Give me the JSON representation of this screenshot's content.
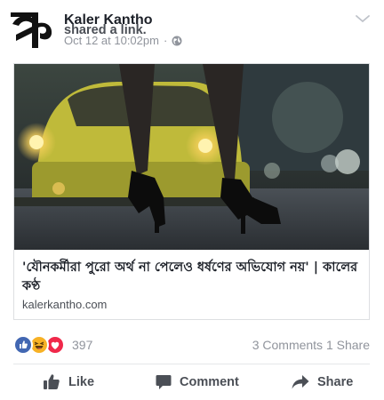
{
  "post": {
    "author": "Kaler Kantho",
    "action": "shared a link.",
    "timestamp": "Oct 12 at 10:02pm",
    "separator": "·",
    "audience_icon": "globe-icon",
    "logo_icon": "kaler-kantho-logo",
    "menu_icon": "chevron-down-icon"
  },
  "link_card": {
    "image": "photo-woman-legs-high-heels-street-night-taxi",
    "title": "'যৌনকর্মীরা পুরো অর্থ না পেলেও ধর্ষণের অভিযোগ নয়' | কালের কণ্ঠ",
    "domain": "kalerkantho.com"
  },
  "engagement": {
    "reactions": [
      "like",
      "haha",
      "love"
    ],
    "reaction_count": "397",
    "comments": "3 Comments",
    "shares": "1 Share"
  },
  "actions": {
    "like": "Like",
    "comment": "Comment",
    "share": "Share"
  },
  "colors": {
    "like_blue": "#4267b2",
    "haha_yellow": "#f7b125",
    "love_red": "#f0284a",
    "meta_gray": "#90949c",
    "action_gray": "#4b4f56"
  }
}
